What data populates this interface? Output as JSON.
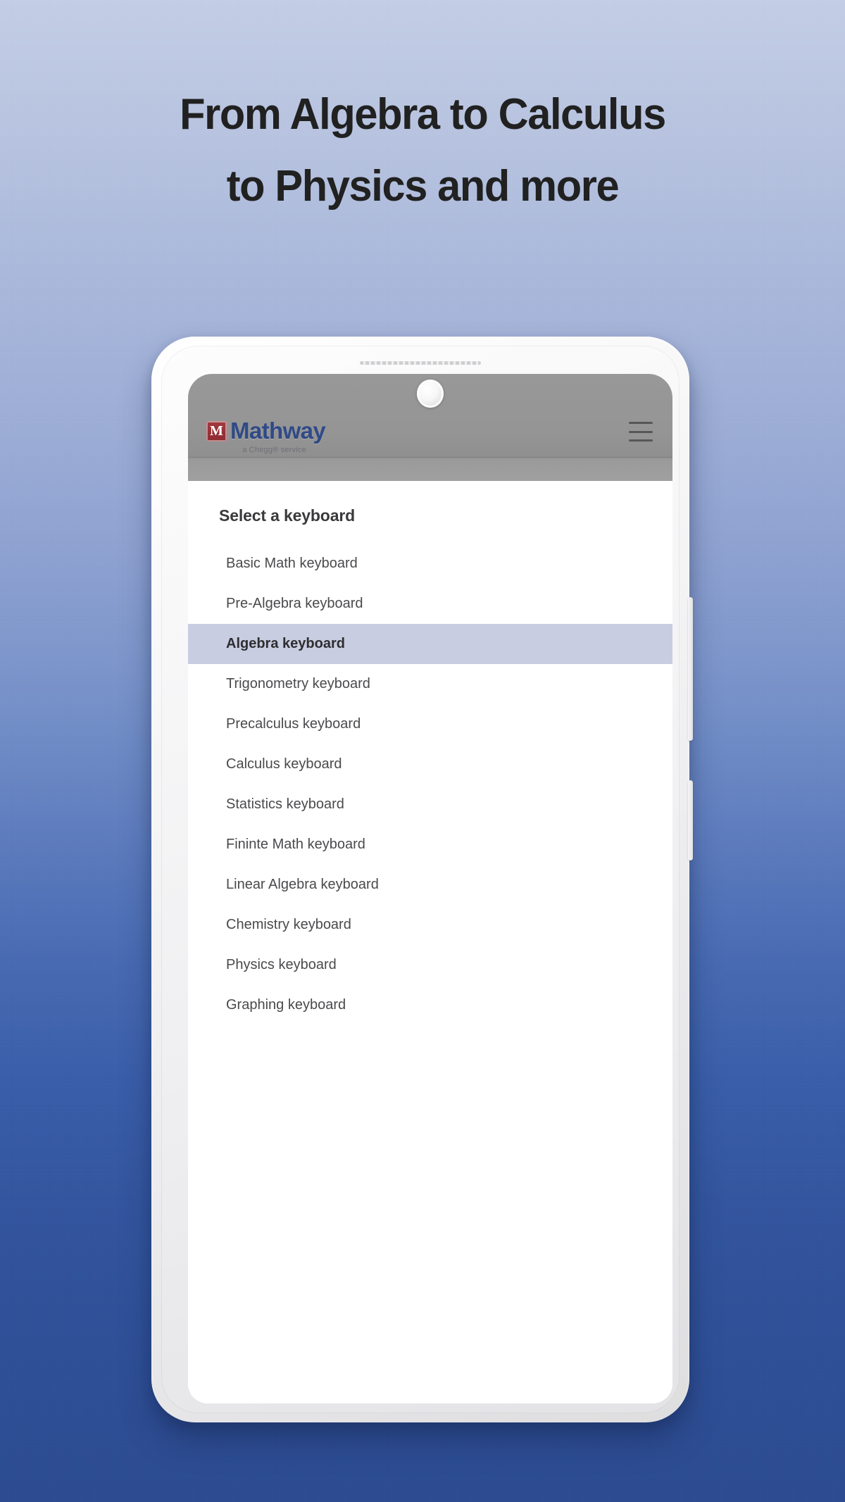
{
  "headline": {
    "line1": "From Algebra to Calculus",
    "line2": "to Physics and more"
  },
  "colors": {
    "background_top": "#c3cde6",
    "background_bottom": "#2c4b90",
    "headline_text": "#212121",
    "app_header_gray": "#959595",
    "logo_mark_red": "#95313 7",
    "logo_text_blue": "#2f4a86",
    "selected_row_bg": "#c8cde1",
    "list_text": "#4a4a4d",
    "panel_bg": "#ffffff"
  },
  "phone": {
    "frame_color": "#f2f2f3",
    "speaker": "speaker-grille",
    "front_camera": "front-camera-lens",
    "buttons": [
      {
        "name": "volume-rocker"
      },
      {
        "name": "power-button"
      }
    ]
  },
  "app_header": {
    "logo_mark_letter": "M",
    "logo_text": "Mathway",
    "logo_tagline": "a Chegg® service",
    "menu_icon": "hamburger-menu-icon"
  },
  "panel": {
    "title": "Select a keyboard",
    "items": [
      {
        "label": "Basic Math keyboard",
        "selected": false
      },
      {
        "label": "Pre-Algebra keyboard",
        "selected": false
      },
      {
        "label": "Algebra keyboard",
        "selected": true
      },
      {
        "label": "Trigonometry keyboard",
        "selected": false
      },
      {
        "label": "Precalculus keyboard",
        "selected": false
      },
      {
        "label": "Calculus keyboard",
        "selected": false
      },
      {
        "label": "Statistics keyboard",
        "selected": false
      },
      {
        "label": "Fininte Math keyboard",
        "selected": false
      },
      {
        "label": "Linear Algebra keyboard",
        "selected": false
      },
      {
        "label": "Chemistry keyboard",
        "selected": false
      },
      {
        "label": "Physics keyboard",
        "selected": false
      },
      {
        "label": "Graphing keyboard",
        "selected": false
      }
    ]
  }
}
